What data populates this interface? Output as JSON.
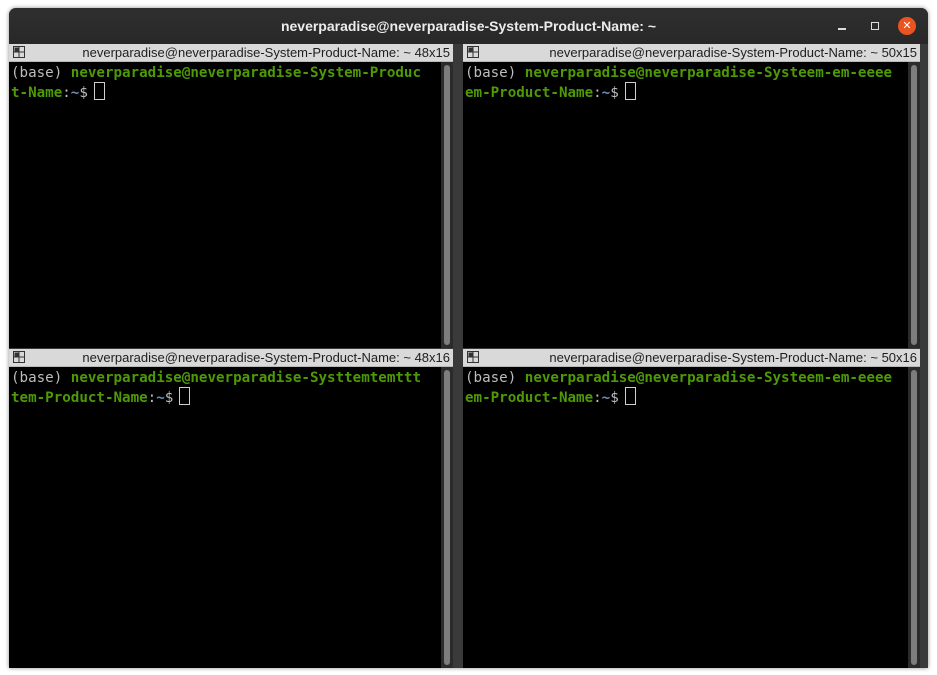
{
  "window": {
    "title": "neverparadise@neverparadise-System-Product-Name: ~",
    "controls": {
      "minimize": "minimize",
      "maximize": "maximize",
      "close": "close"
    }
  },
  "panes": [
    {
      "header": "neverparadise@neverparadise-System-Product-Name: ~ 48x15",
      "line1_prefix": "(base) ",
      "line1_user": "neverparadise@neverparadise-System-Produc",
      "line2_user": "t-Name",
      "colon": ":",
      "path": "~",
      "prompt": "$"
    },
    {
      "header": "neverparadise@neverparadise-System-Product-Name: ~ 50x15",
      "line1_prefix": "(base) ",
      "line1_user": "neverparadise@neverparadise-Systeem-em-eeee",
      "line2_user": "em-Product-Name",
      "colon": ":",
      "path": "~",
      "prompt": "$"
    },
    {
      "header": "neverparadise@neverparadise-System-Product-Name: ~ 48x16",
      "line1_prefix": "(base) ",
      "line1_user": "neverparadise@neverparadise-Systtemtemttt",
      "line2_user": "tem-Product-Name",
      "colon": ":",
      "path": "~",
      "prompt": "$"
    },
    {
      "header": "neverparadise@neverparadise-System-Product-Name: ~ 50x16",
      "line1_prefix": "(base) ",
      "line1_user": "neverparadise@neverparadise-Systeem-em-eeee",
      "line2_user": "em-Product-Name",
      "colon": ":",
      "path": "~",
      "prompt": "$"
    }
  ],
  "colors": {
    "user_host": "#4e9a06",
    "path": "#6c8fb8",
    "text": "#bdbdbd",
    "terminal_bg": "#000000",
    "close_button": "#e95420"
  }
}
